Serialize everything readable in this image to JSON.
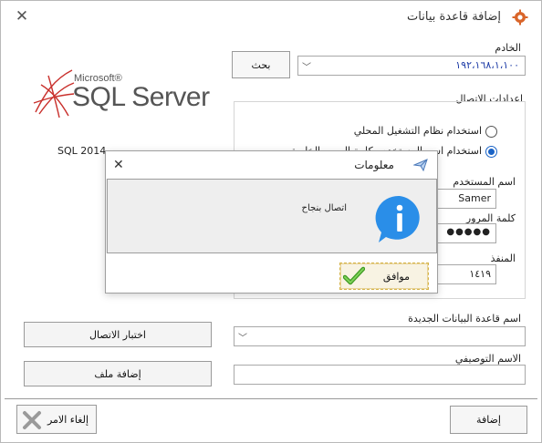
{
  "window": {
    "title": "إضافة قاعدة بيانات",
    "close_glyph": "✕",
    "icon": "gear-icon"
  },
  "logo": {
    "brand_small": "Microsoft®",
    "brand_large": "SQL Server",
    "version_text": "SQL 2014"
  },
  "server": {
    "label": "الخادم",
    "value": "١٩٢،١٦٨،١،١٠٠",
    "search_button": "بحث"
  },
  "connection": {
    "group_label": "اعدادات الاتصال",
    "option_windows": "استخدام نظام التشغيل المحلي",
    "option_sql": "استخدام اسم المستخدم وكلمة المرور الخاصة",
    "selected": "sql",
    "username_label": "اسم المستخدم",
    "username_value": "Samer",
    "password_label": "كلمة المرور",
    "password_value": "●●●●●",
    "port_label": "المنفذ",
    "port_value": "١٤١٩"
  },
  "database": {
    "name_label": "اسم قاعدة البيانات الجديدة",
    "name_value": "",
    "description_label": "الاسم التوصيفي",
    "description_value": ""
  },
  "buttons": {
    "test_connection": "اختبار الاتصال",
    "add_file": "إضافة ملف",
    "add": "إضافة",
    "cancel": "إلغاء الامر"
  },
  "modal": {
    "title": "معلومات",
    "message": "اتصال بنجاح",
    "ok": "موافق",
    "close_glyph": "✕"
  },
  "colors": {
    "accent_orange": "#e07a1f",
    "info_blue": "#2a8ee8",
    "check_green": "#4caf2e",
    "ok_border": "#d5b347",
    "cancel_red": "#c62f2f"
  }
}
